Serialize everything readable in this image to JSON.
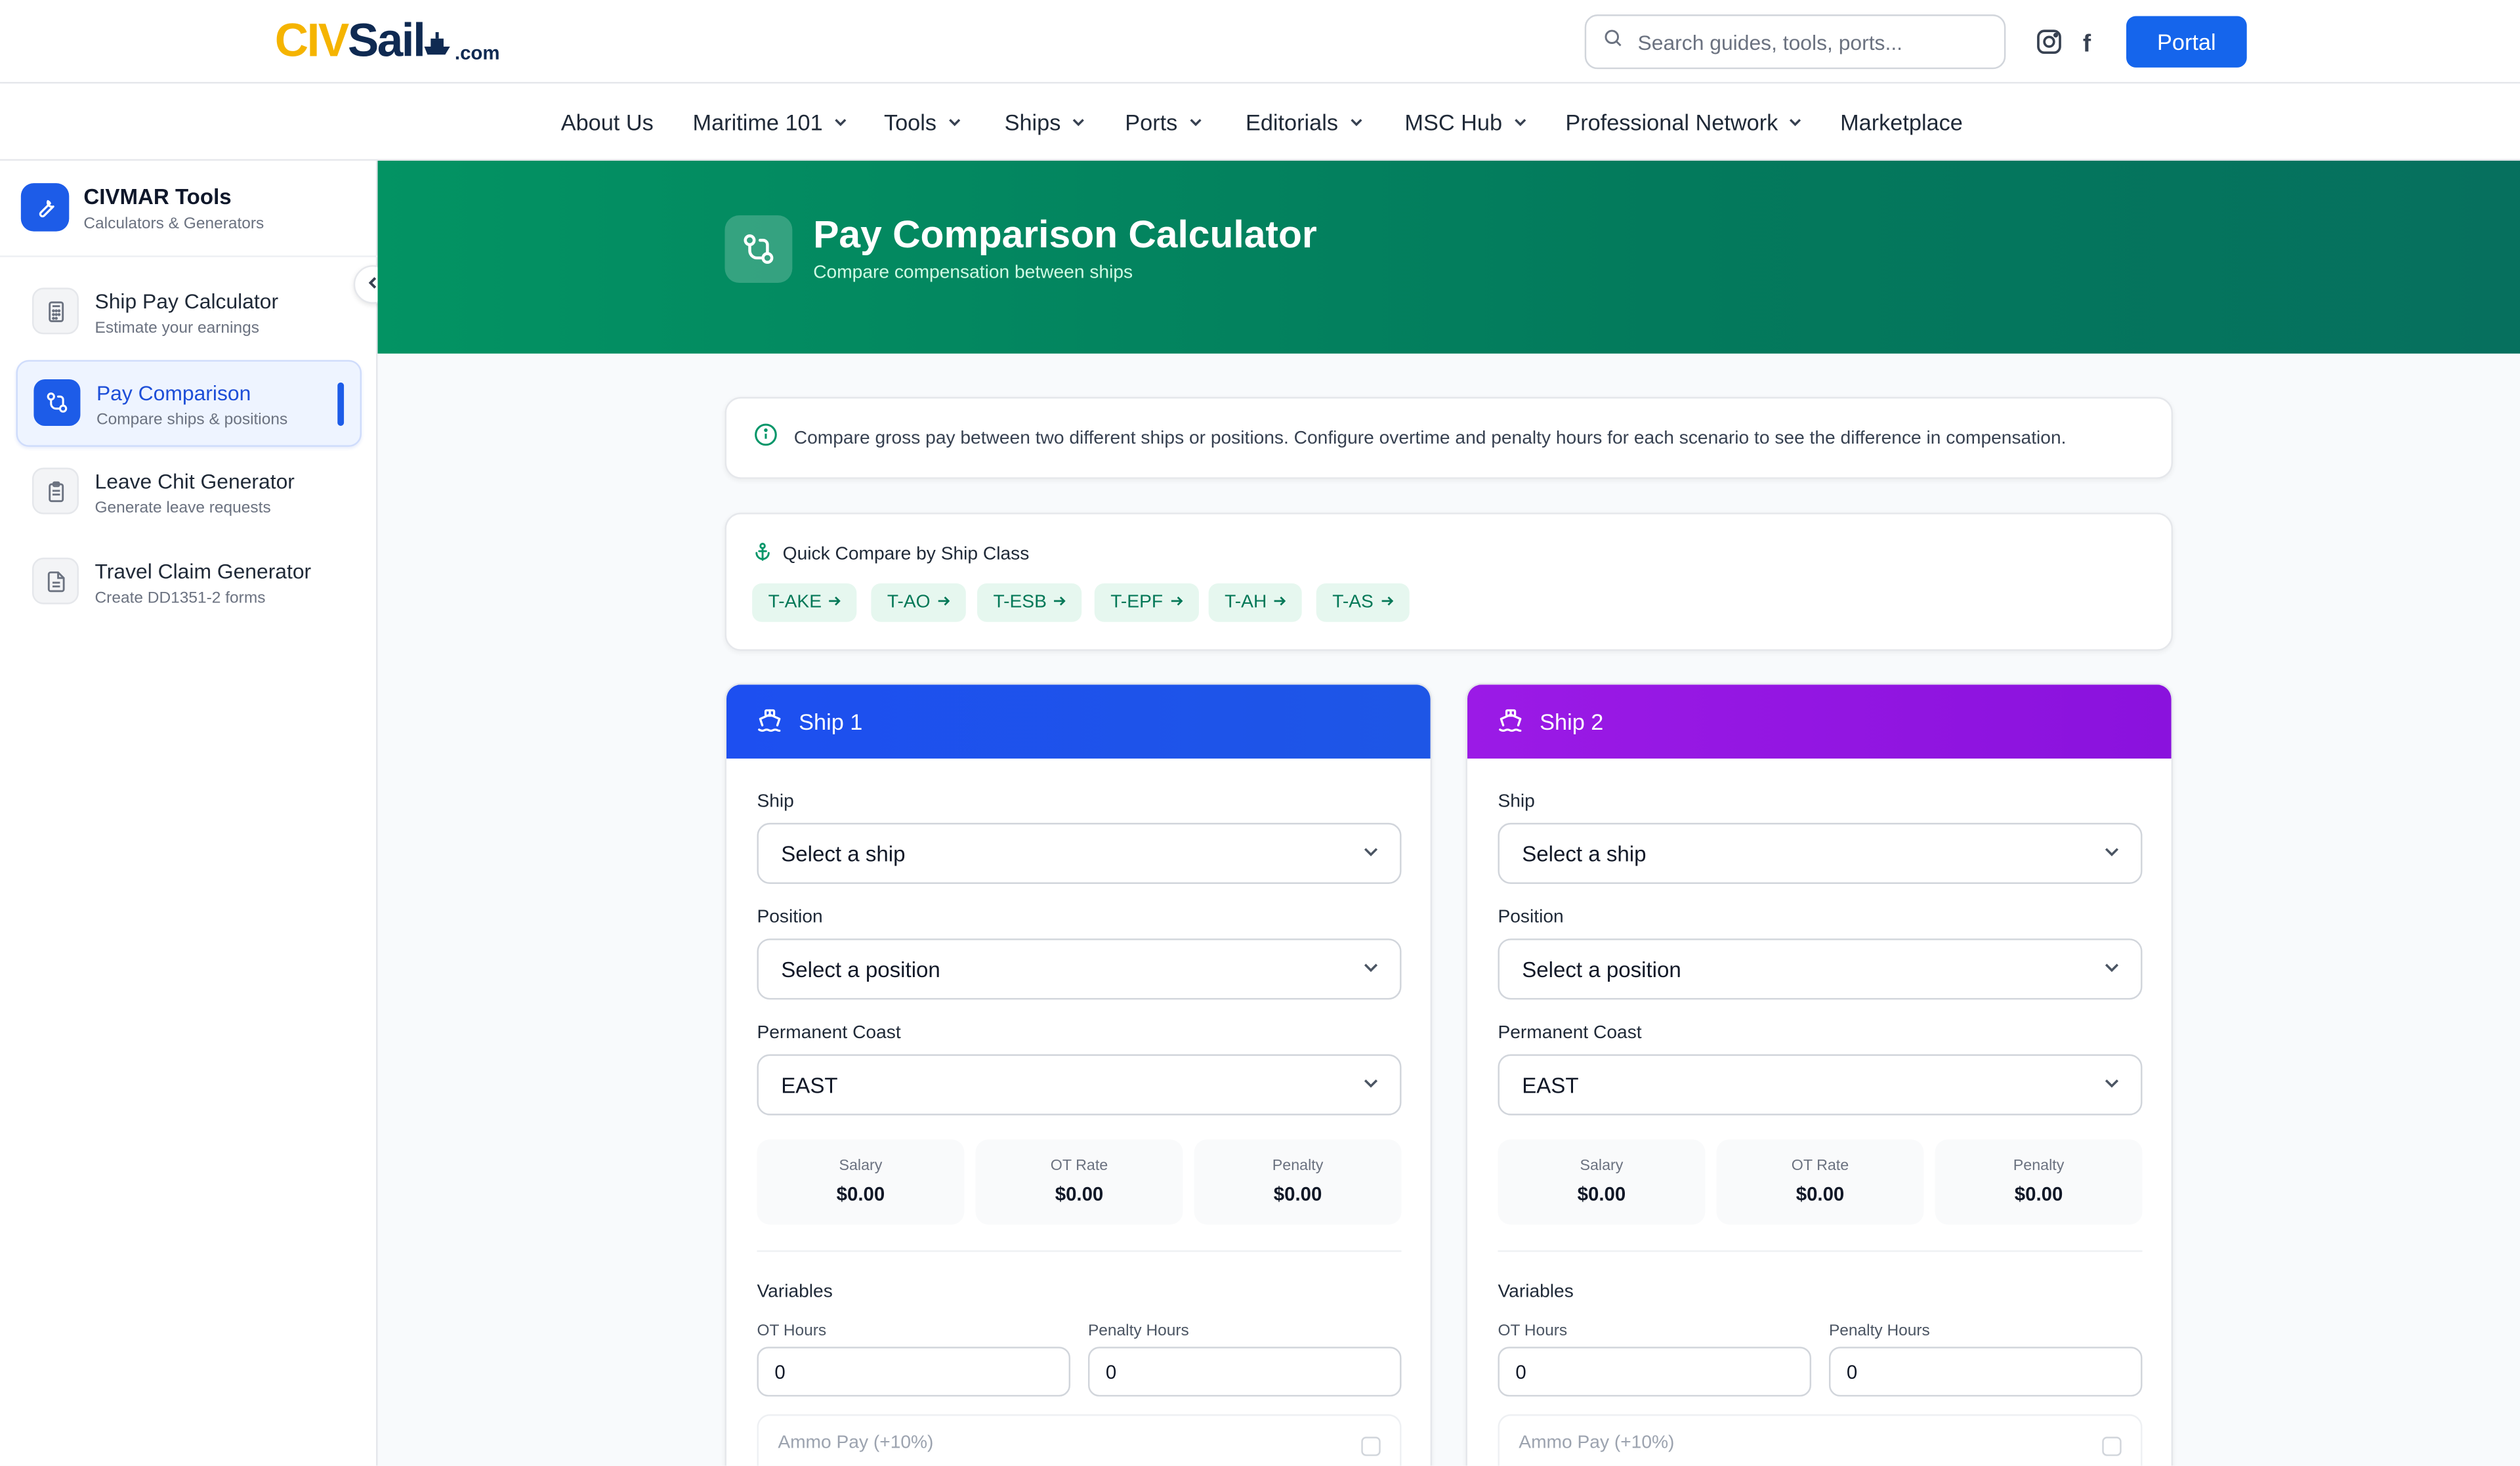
{
  "brand": {
    "logo_civ": "CIV",
    "logo_sail": "Sail",
    "logo_com": ".com"
  },
  "header": {
    "search_placeholder": "Search guides, tools, ports...",
    "portal_label": "Portal",
    "facebook_glyph": "f"
  },
  "nav": [
    {
      "label": "About Us",
      "dropdown": false
    },
    {
      "label": "Maritime 101",
      "dropdown": true
    },
    {
      "label": "Tools",
      "dropdown": true
    },
    {
      "label": "Ships",
      "dropdown": true
    },
    {
      "label": "Ports",
      "dropdown": true
    },
    {
      "label": "Editorials",
      "dropdown": true
    },
    {
      "label": "MSC Hub",
      "dropdown": true
    },
    {
      "label": "Professional Network",
      "dropdown": true
    },
    {
      "label": "Marketplace",
      "dropdown": false
    }
  ],
  "sidebar": {
    "title": "CIVMAR Tools",
    "subtitle": "Calculators & Generators",
    "items": [
      {
        "label": "Ship Pay Calculator",
        "sub": "Estimate your earnings",
        "icon": "calculator-icon"
      },
      {
        "label": "Pay Comparison",
        "sub": "Compare ships & positions",
        "icon": "compare-icon",
        "active": true
      },
      {
        "label": "Leave Chit Generator",
        "sub": "Generate leave requests",
        "icon": "clipboard-icon"
      },
      {
        "label": "Travel Claim Generator",
        "sub": "Create DD1351-2 forms",
        "icon": "document-icon"
      }
    ]
  },
  "hero": {
    "title": "Pay Comparison Calculator",
    "subtitle": "Compare compensation between ships"
  },
  "info": {
    "text": "Compare gross pay between two different ships or positions. Configure overtime and penalty hours for each scenario to see the difference in compensation."
  },
  "quick_compare": {
    "title": "Quick Compare by Ship Class",
    "classes": [
      "T-AKE",
      "T-AO",
      "T-ESB",
      "T-EPF",
      "T-AH",
      "T-AS"
    ]
  },
  "ships": [
    {
      "title": "Ship 1",
      "color": "#1d4ff0",
      "ship_label": "Ship",
      "ship_value": "Select a ship",
      "position_label": "Position",
      "position_value": "Select a position",
      "coast_label": "Permanent Coast",
      "coast_value": "EAST",
      "salary_label": "Salary",
      "salary_value": "$0.00",
      "ot_rate_label": "OT Rate",
      "ot_rate_value": "$0.00",
      "penalty_label": "Penalty",
      "penalty_value": "$0.00",
      "variables_label": "Variables",
      "ot_hours_label": "OT Hours",
      "ot_hours_value": "0",
      "penalty_hours_label": "Penalty Hours",
      "penalty_hours_value": "0",
      "ammo_label": "Ammo Pay (+10%)"
    },
    {
      "title": "Ship 2",
      "color": "#9b1ae6",
      "ship_label": "Ship",
      "ship_value": "Select a ship",
      "position_label": "Position",
      "position_value": "Select a position",
      "coast_label": "Permanent Coast",
      "coast_value": "EAST",
      "salary_label": "Salary",
      "salary_value": "$0.00",
      "ot_rate_label": "OT Rate",
      "ot_rate_value": "$0.00",
      "penalty_label": "Penalty",
      "penalty_value": "$0.00",
      "variables_label": "Variables",
      "ot_hours_label": "OT Hours",
      "ot_hours_value": "0",
      "penalty_hours_label": "Penalty Hours",
      "penalty_hours_value": "0",
      "ammo_label": "Ammo Pay (+10%)"
    }
  ]
}
